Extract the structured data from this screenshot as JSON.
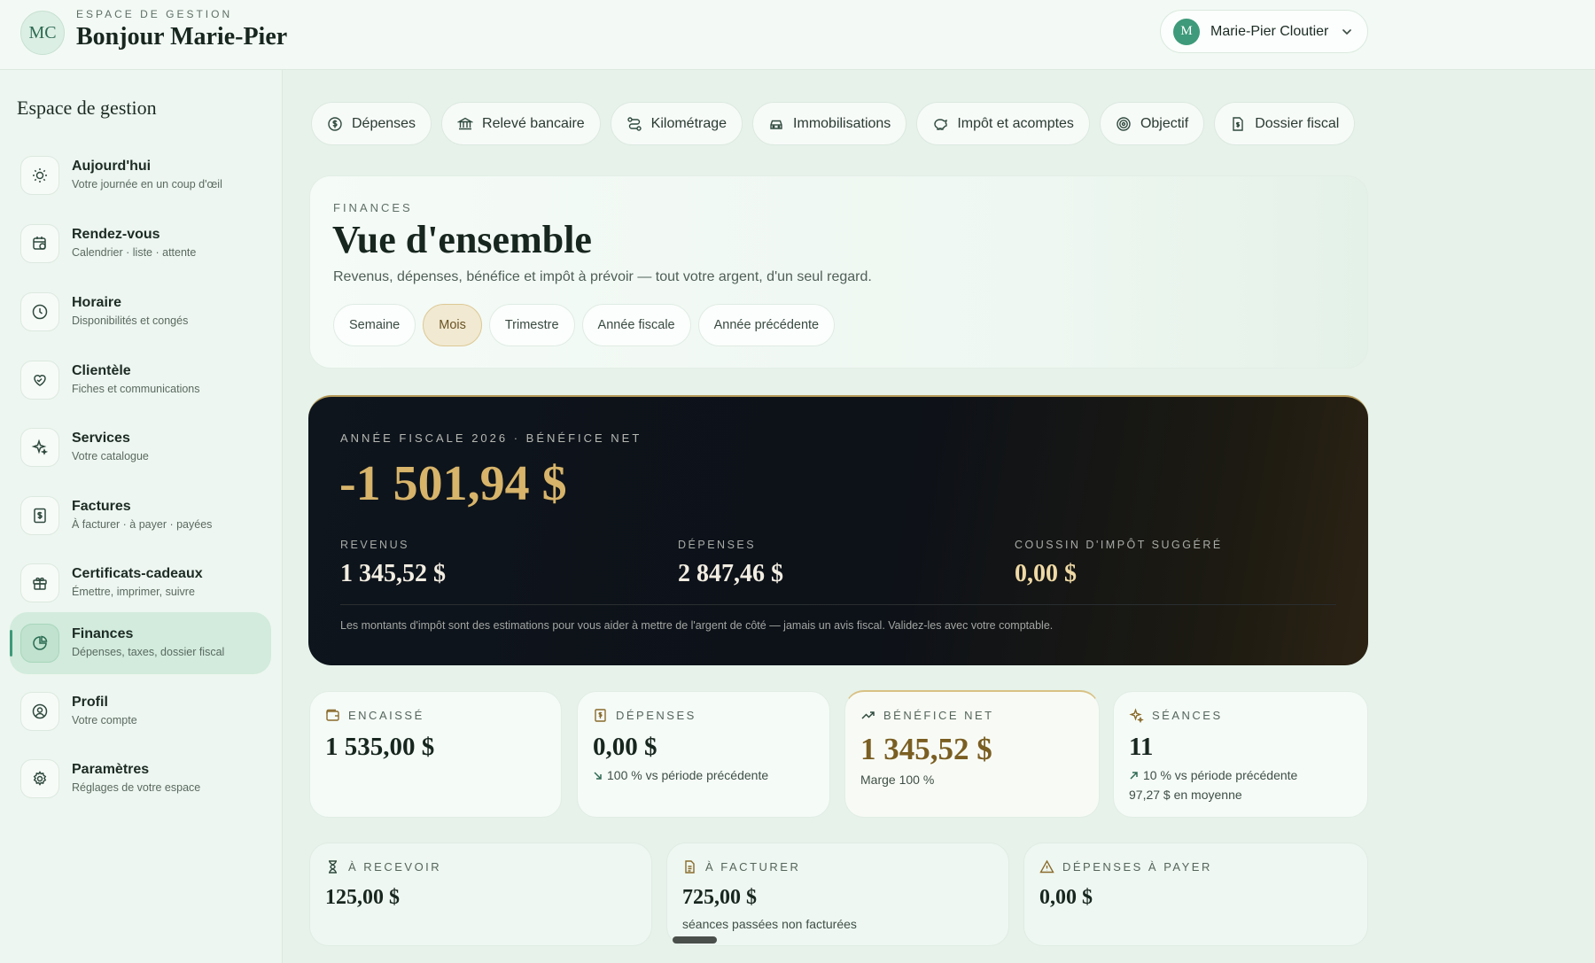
{
  "header": {
    "avatar_initials": "MC",
    "eyebrow": "ESPACE DE GESTION",
    "greeting": "Bonjour Marie-Pier",
    "user_initial": "M",
    "user_name": "Marie-Pier Cloutier"
  },
  "sidebar": {
    "title": "Espace de gestion",
    "items": [
      {
        "label": "Aujourd'hui",
        "sub": "Votre journée en un coup d'œil",
        "icon": "sun-icon"
      },
      {
        "label": "Rendez-vous",
        "sub": "Calendrier · liste · attente",
        "icon": "calendar-clock-icon"
      },
      {
        "label": "Horaire",
        "sub": "Disponibilités et congés",
        "icon": "clock-icon"
      },
      {
        "label": "Clientèle",
        "sub": "Fiches et communications",
        "icon": "heart-hand-icon"
      },
      {
        "label": "Services",
        "sub": "Votre catalogue",
        "icon": "sparkles-icon"
      },
      {
        "label": "Factures",
        "sub": "À facturer · à payer · payées",
        "icon": "invoice-icon"
      },
      {
        "label": "Certificats-cadeaux",
        "sub": "Émettre, imprimer, suivre",
        "icon": "gift-icon"
      },
      {
        "label": "Finances",
        "sub": "Dépenses, taxes, dossier fiscal",
        "icon": "pie-chart-icon",
        "active": true
      },
      {
        "label": "Profil",
        "sub": "Votre compte",
        "icon": "user-circle-icon"
      },
      {
        "label": "Paramètres",
        "sub": "Réglages de votre espace",
        "icon": "gear-icon"
      }
    ]
  },
  "tabs": [
    {
      "label": "Dépenses",
      "icon": "dollar-circle-icon"
    },
    {
      "label": "Relevé bancaire",
      "icon": "bank-icon"
    },
    {
      "label": "Kilométrage",
      "icon": "route-icon"
    },
    {
      "label": "Immobilisations",
      "icon": "car-icon"
    },
    {
      "label": "Impôt et acomptes",
      "icon": "piggy-bank-icon"
    },
    {
      "label": "Objectif",
      "icon": "target-icon"
    },
    {
      "label": "Dossier fiscal",
      "icon": "file-dollar-icon"
    }
  ],
  "hero": {
    "eyebrow": "FINANCES",
    "title": "Vue d'ensemble",
    "description": "Revenus, dépenses, bénéfice et impôt à prévoir — tout votre argent, d'un seul regard.",
    "periods": [
      "Semaine",
      "Mois",
      "Trimestre",
      "Année fiscale",
      "Année précédente"
    ],
    "active_period": "Mois"
  },
  "summary": {
    "eyebrow": "ANNÉE FISCALE 2026 · BÉNÉFICE NET",
    "net_profit": "-1 501,94 $",
    "revenue_label": "REVENUS",
    "revenue": "1 345,52 $",
    "expenses_label": "DÉPENSES",
    "expenses": "2 847,46 $",
    "tax_label": "COUSSIN D'IMPÔT SUGGÉRÉ",
    "tax": "0,00 $",
    "note": "Les montants d'impôt sont des estimations pour vous aider à mettre de l'argent de côté — jamais un avis fiscal. Validez-les avec votre comptable."
  },
  "kpis": {
    "collected": {
      "label": "ENCAISSÉ",
      "value": "1 535,00 $"
    },
    "expenses": {
      "label": "DÉPENSES",
      "value": "0,00 $",
      "trend": "100 % vs période précédente"
    },
    "net": {
      "label": "BÉNÉFICE NET",
      "value": "1 345,52 $",
      "margin": "Marge 100 %"
    },
    "sessions": {
      "label": "SÉANCES",
      "value": "11",
      "trend": "10 % vs période précédente",
      "average": "97,27 $ en moyenne"
    }
  },
  "pending": {
    "receivable": {
      "label": "À RECEVOIR",
      "value": "125,00 $"
    },
    "to_invoice": {
      "label": "À FACTURER",
      "value": "725,00 $",
      "sub": "séances passées non facturées"
    },
    "payable": {
      "label": "DÉPENSES À PAYER",
      "value": "0,00 $"
    }
  },
  "colors": {
    "accent": "#3e9a7a",
    "gold": "#d7b46a",
    "dark_card": "#0e151d"
  }
}
